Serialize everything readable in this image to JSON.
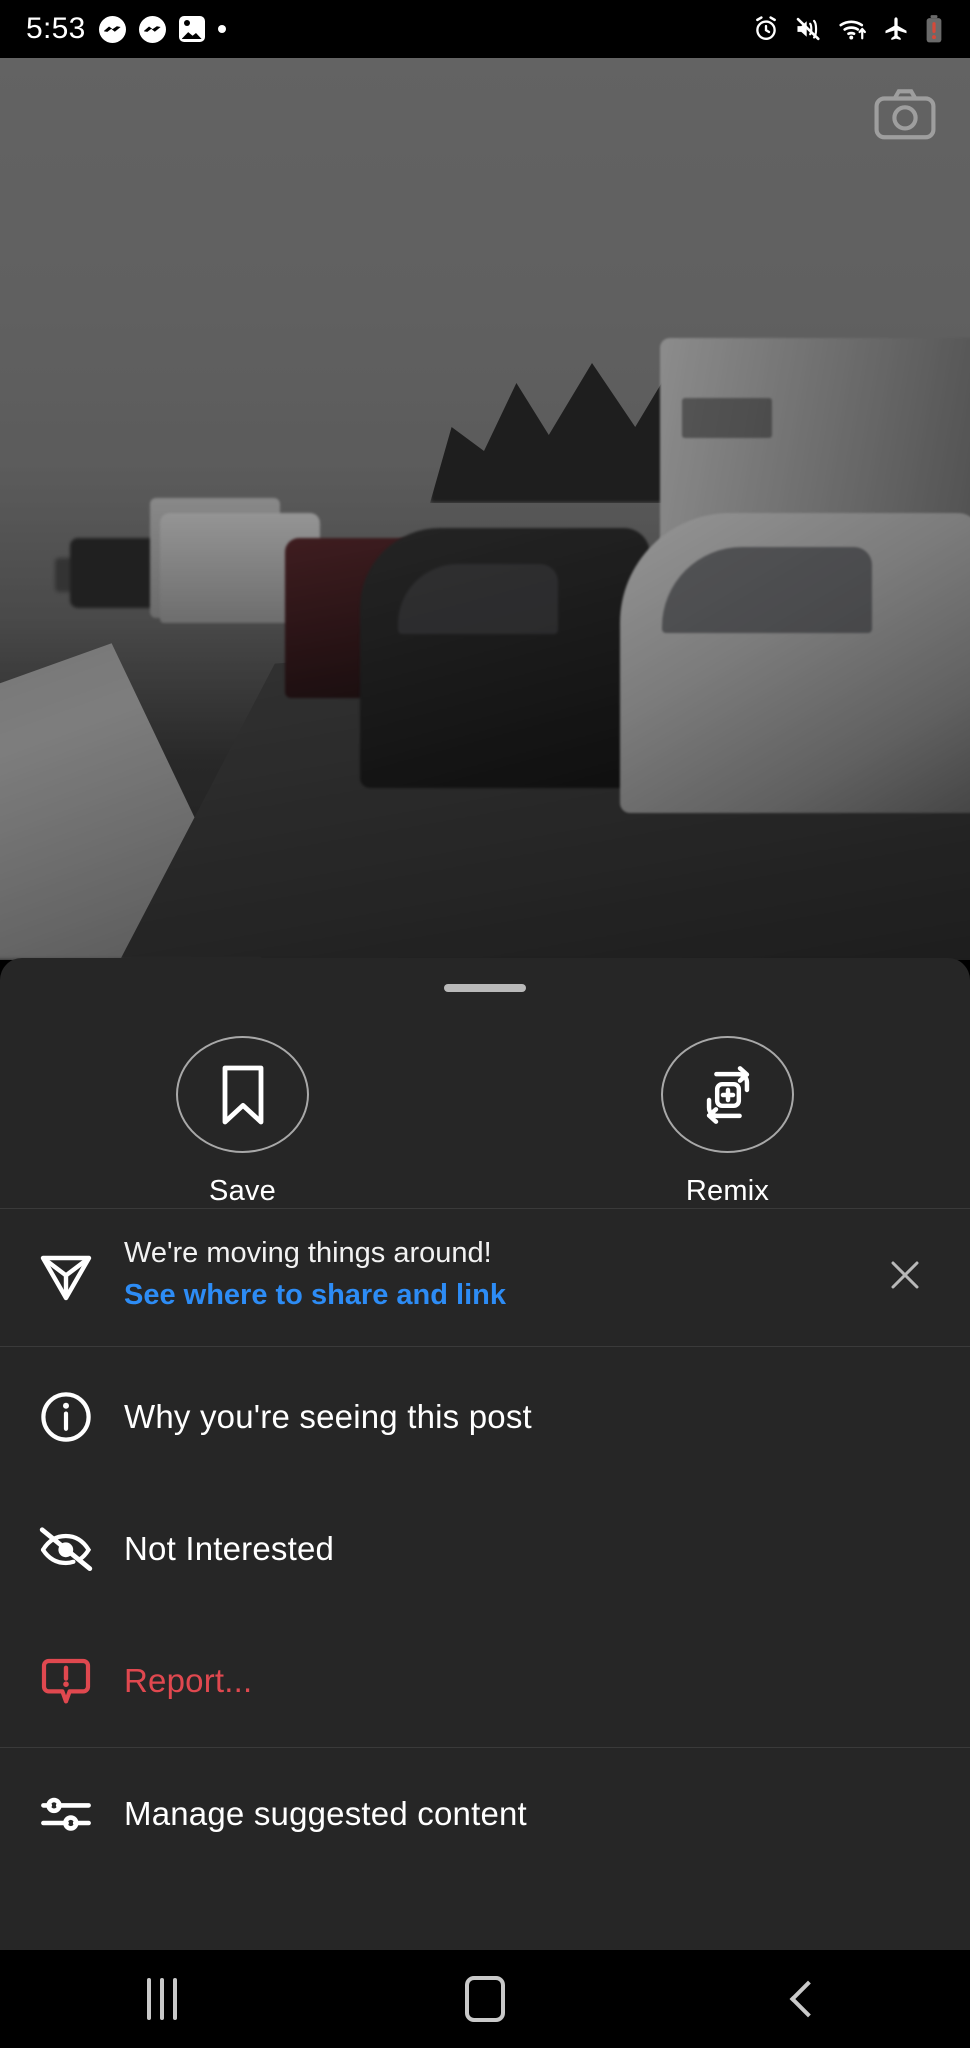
{
  "status_bar": {
    "time": "5:53",
    "left_icons": [
      "messenger-icon",
      "messenger-icon",
      "photos-icon",
      "dot-icon"
    ],
    "right_icons": [
      "alarm-icon",
      "vibrate-mute-icon",
      "wifi-icon",
      "airplane-mode-icon",
      "battery-low-icon"
    ],
    "battery_color": "#c0392b"
  },
  "media": {
    "description": "Grayscale video of stopped traffic on a wet highway with an RV and trees on the right",
    "overlay_icon": "camera-icon"
  },
  "sheet": {
    "handle": "drag-handle",
    "actions": [
      {
        "label": "Save",
        "icon": "bookmark-icon"
      },
      {
        "label": "Remix",
        "icon": "remix-icon"
      }
    ],
    "banner": {
      "icon": "share-paper-plane-icon",
      "title": "We're moving things around!",
      "link": "See where to share and link",
      "link_color": "#2d8cf5",
      "close_icon": "close-icon"
    },
    "menu": [
      {
        "label": "Why you're seeing this post",
        "icon": "info-circle-icon",
        "danger": false
      },
      {
        "label": "Not Interested",
        "icon": "eye-off-icon",
        "danger": false
      },
      {
        "label": "Report...",
        "icon": "report-warning-icon",
        "danger": true
      },
      {
        "label": "Manage suggested content",
        "icon": "sliders-icon",
        "danger": false
      }
    ],
    "danger_color": "#e0484f",
    "background_color": "#262626"
  },
  "nav_bar": {
    "buttons": [
      {
        "name": "recents",
        "icon": "recents-icon"
      },
      {
        "name": "home",
        "icon": "home-icon"
      },
      {
        "name": "back",
        "icon": "back-icon"
      }
    ]
  }
}
